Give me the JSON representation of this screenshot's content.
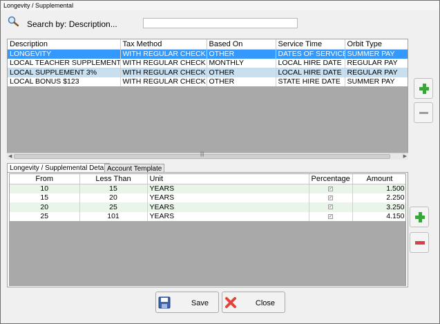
{
  "window": {
    "title": "Longevity / Supplemental"
  },
  "search": {
    "label": "Search by: Description...",
    "value": ""
  },
  "main_table": {
    "columns": [
      "Description",
      "Tax Method",
      "Based On",
      "Service Time",
      "Orbit Type"
    ],
    "rows": [
      [
        "LONGEVITY",
        "WITH REGULAR CHECK",
        "OTHER",
        "DATES OF SERVICE",
        "SUMMER PAY"
      ],
      [
        "LOCAL TEACHER SUPPLEMENT",
        "WITH REGULAR CHECK",
        "MONTHLY",
        "LOCAL HIRE DATE",
        "REGULAR PAY"
      ],
      [
        "LOCAL SUPPLEMENT 3%",
        "WITH REGULAR CHECK",
        "OTHER",
        "LOCAL HIRE DATE",
        "REGULAR PAY"
      ],
      [
        "LOCAL BONUS $123",
        "WITH REGULAR CHECK",
        "OTHER",
        "STATE HIRE DATE",
        "SUMMER PAY"
      ]
    ],
    "selected_row": 0
  },
  "tabs": [
    {
      "label": "Longevity / Supplemental Detail",
      "active": true
    },
    {
      "label": "Account Template",
      "active": false
    }
  ],
  "detail_table": {
    "columns": [
      "From",
      "Less Than",
      "Unit",
      "Percentage",
      "Amount"
    ],
    "rows": [
      [
        "10",
        "15",
        "YEARS",
        "✓",
        "1.500"
      ],
      [
        "15",
        "20",
        "YEARS",
        "✓",
        "2.250"
      ],
      [
        "20",
        "25",
        "YEARS",
        "✓",
        "3.250"
      ],
      [
        "25",
        "101",
        "YEARS",
        "✓",
        "4.150"
      ]
    ]
  },
  "buttons": {
    "save": "Save",
    "close": "Close"
  },
  "colors": {
    "selection": "#3399ff",
    "add": "#3aa63a",
    "remove": "#d94040"
  }
}
